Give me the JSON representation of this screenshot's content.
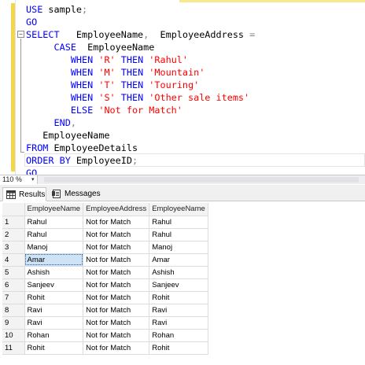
{
  "editor": {
    "lines": [
      [
        {
          "t": "USE",
          "c": "kw"
        },
        {
          "t": " sample",
          "c": "id"
        },
        {
          "t": ";",
          "c": "op"
        }
      ],
      [
        {
          "t": "GO",
          "c": "kw"
        }
      ],
      [
        {
          "t": "SELECT",
          "c": "kw"
        },
        {
          "t": "   EmployeeName",
          "c": "id"
        },
        {
          "t": ",",
          "c": "op"
        },
        {
          "t": "  EmployeeAddress ",
          "c": "id"
        },
        {
          "t": "=",
          "c": "op"
        }
      ],
      [
        {
          "t": "     CASE",
          "c": "kw"
        },
        {
          "t": "  EmployeeName",
          "c": "id"
        }
      ],
      [
        {
          "t": "        WHEN ",
          "c": "kw"
        },
        {
          "t": "'R'",
          "c": "str"
        },
        {
          "t": " THEN ",
          "c": "kw"
        },
        {
          "t": "'Rahul'",
          "c": "str"
        }
      ],
      [
        {
          "t": "        WHEN ",
          "c": "kw"
        },
        {
          "t": "'M'",
          "c": "str"
        },
        {
          "t": " THEN ",
          "c": "kw"
        },
        {
          "t": "'Mountain'",
          "c": "str"
        }
      ],
      [
        {
          "t": "        WHEN ",
          "c": "kw"
        },
        {
          "t": "'T'",
          "c": "str"
        },
        {
          "t": " THEN ",
          "c": "kw"
        },
        {
          "t": "'Touring'",
          "c": "str"
        }
      ],
      [
        {
          "t": "        WHEN ",
          "c": "kw"
        },
        {
          "t": "'S'",
          "c": "str"
        },
        {
          "t": " THEN ",
          "c": "kw"
        },
        {
          "t": "'Other sale items'",
          "c": "str"
        }
      ],
      [
        {
          "t": "        ELSE ",
          "c": "kw"
        },
        {
          "t": "'Not for Match'",
          "c": "str"
        }
      ],
      [
        {
          "t": "     END",
          "c": "kw"
        },
        {
          "t": ",",
          "c": "op"
        }
      ],
      [
        {
          "t": "   EmployeeName",
          "c": "id"
        }
      ],
      [
        {
          "t": "FROM",
          "c": "kw"
        },
        {
          "t": " EmployeeDetails",
          "c": "id"
        }
      ],
      [
        {
          "t": "ORDER BY",
          "c": "kw"
        },
        {
          "t": " EmployeeID",
          "c": "id"
        },
        {
          "t": ";",
          "c": "op"
        }
      ],
      [
        {
          "t": "GO",
          "c": "kw"
        }
      ]
    ],
    "fold_symbol": "−"
  },
  "zoom": {
    "level": "110 %",
    "arrow": "▾"
  },
  "tabs": {
    "results_label": "Results",
    "messages_label": "Messages"
  },
  "grid": {
    "columns": [
      "EmployeeName",
      "EmployeeAddress",
      "EmployeeName"
    ],
    "rows": [
      [
        "1",
        "Rahul",
        "Not for Match",
        "Rahul"
      ],
      [
        "2",
        "Rahul",
        "Not for Match",
        "Rahul"
      ],
      [
        "3",
        "Manoj",
        "Not for Match",
        "Manoj"
      ],
      [
        "4",
        "Amar",
        "Not for Match",
        "Amar"
      ],
      [
        "5",
        "Ashish",
        "Not for Match",
        "Ashish"
      ],
      [
        "6",
        "Sanjeev",
        "Not for Match",
        "Sanjeev"
      ],
      [
        "7",
        "Rohit",
        "Not for Match",
        "Rohit"
      ],
      [
        "8",
        "Ravi",
        "Not for Match",
        "Ravi"
      ],
      [
        "9",
        "Ravi",
        "Not for Match",
        "Ravi"
      ],
      [
        "10",
        "Rohan",
        "Not for Match",
        "Rohan"
      ],
      [
        "11",
        "Rohit",
        "Not for Match",
        "Rohit"
      ]
    ],
    "selected_row": 3
  }
}
